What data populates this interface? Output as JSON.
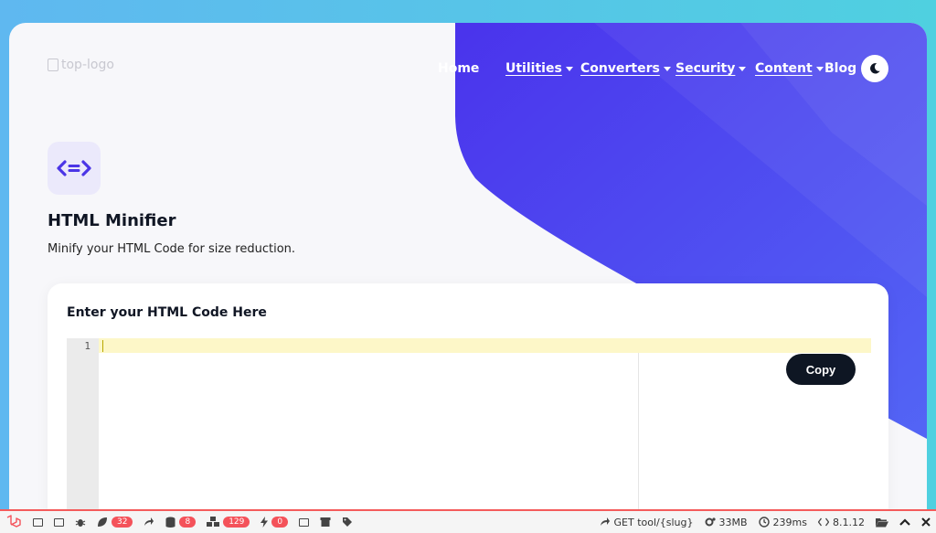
{
  "nav": {
    "logo_alt": "top-logo",
    "links": [
      {
        "label": "Home",
        "dropdown": false
      },
      {
        "label": "Utilities",
        "dropdown": true
      },
      {
        "label": "Converters",
        "dropdown": true
      },
      {
        "label": "Security",
        "dropdown": true
      },
      {
        "label": "Content",
        "dropdown": true
      },
      {
        "label": "Blog",
        "dropdown": false
      }
    ],
    "theme_icon": "moon-icon"
  },
  "tool": {
    "icon": "code-arrows-icon",
    "title": "HTML Minifier",
    "subtitle": "Minify your HTML Code for size reduction."
  },
  "editor_card": {
    "title": "Enter your HTML Code Here",
    "line_numbers": [
      "1"
    ],
    "copy_label": "Copy"
  },
  "debugbar": {
    "badges": {
      "views": "32",
      "queries": "8",
      "models": "129",
      "events": "0"
    },
    "route": "GET tool/{slug}",
    "memory": "33MB",
    "time": "239ms",
    "version": "8.1.12"
  },
  "colors": {
    "accent": "#4b44f0",
    "button_dark": "#0e1623",
    "debug_red": "#f45b5b"
  }
}
